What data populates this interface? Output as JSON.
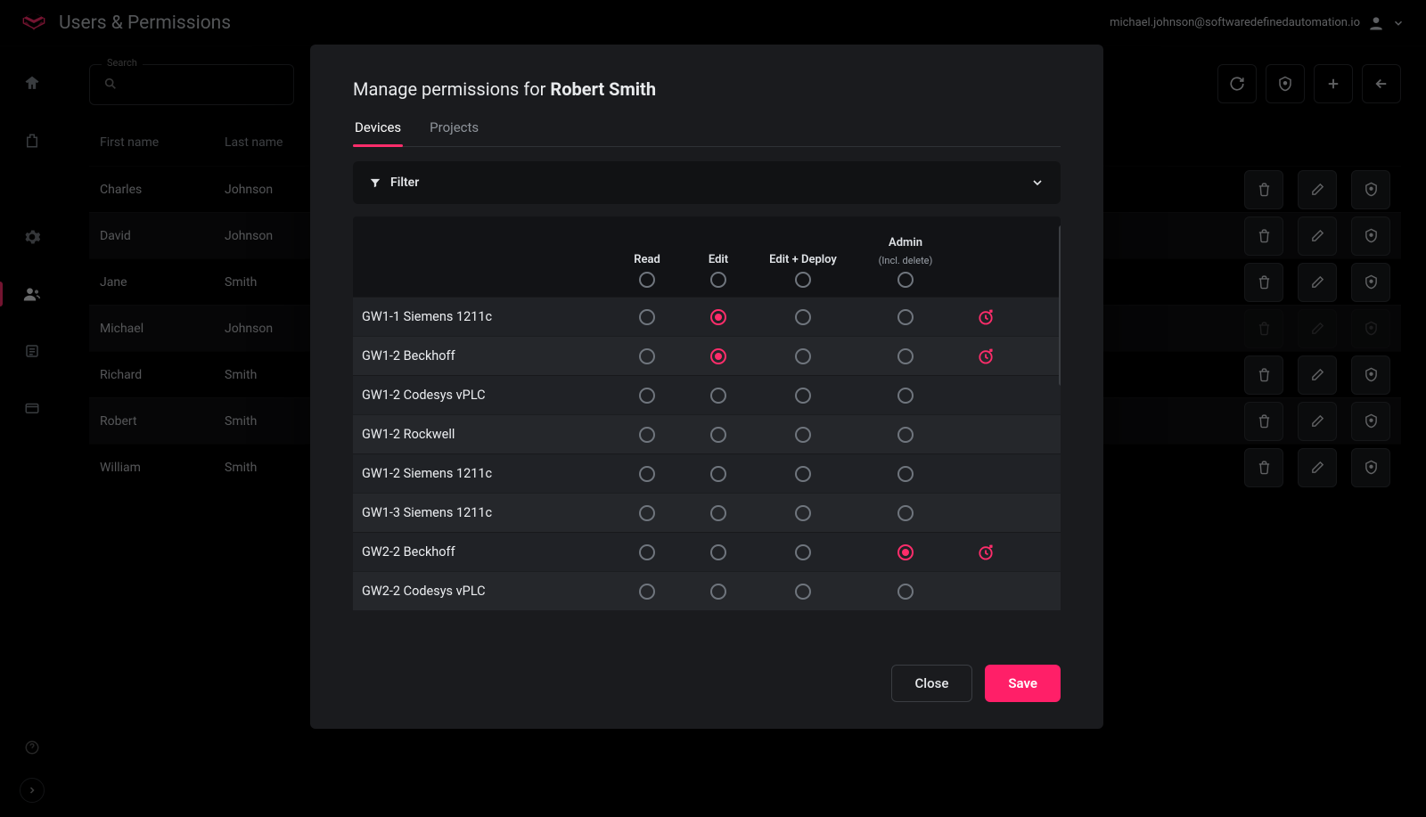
{
  "page_title": "Users & Permissions",
  "user_email": "michael.johnson@softwaredefinedautomation.io",
  "search": {
    "label": "Search",
    "value": ""
  },
  "columns": {
    "first": "First name",
    "last": "Last name"
  },
  "users": [
    {
      "first": "Charles",
      "last": "Johnson",
      "disabled": false
    },
    {
      "first": "David",
      "last": "Johnson",
      "disabled": false
    },
    {
      "first": "Jane",
      "last": "Smith",
      "disabled": false
    },
    {
      "first": "Michael",
      "last": "Johnson",
      "disabled": true
    },
    {
      "first": "Richard",
      "last": "Smith",
      "disabled": false
    },
    {
      "first": "Robert",
      "last": "Smith",
      "disabled": false
    },
    {
      "first": "William",
      "last": "Smith",
      "disabled": false
    }
  ],
  "modal": {
    "title_prefix": "Manage permissions for ",
    "title_subject": "Robert Smith",
    "tabs": {
      "devices": "Devices",
      "projects": "Projects"
    },
    "filter_label": "Filter",
    "perm_columns": {
      "read": "Read",
      "edit": "Edit",
      "editdeploy": "Edit + Deploy",
      "admin": "Admin",
      "admin_sub": "(Incl. delete)"
    },
    "devices": [
      {
        "name": "GW1-1 Siemens 1211c",
        "sel": "edit",
        "temp": true
      },
      {
        "name": "GW1-2 Beckhoff",
        "sel": "edit",
        "temp": true
      },
      {
        "name": "GW1-2 Codesys vPLC",
        "sel": null,
        "temp": false
      },
      {
        "name": "GW1-2 Rockwell",
        "sel": null,
        "temp": false
      },
      {
        "name": "GW1-2 Siemens 1211c",
        "sel": null,
        "temp": false
      },
      {
        "name": "GW1-3 Siemens 1211c",
        "sel": null,
        "temp": false
      },
      {
        "name": "GW2-2 Beckhoff",
        "sel": "admin",
        "temp": true
      },
      {
        "name": "GW2-2 Codesys vPLC",
        "sel": null,
        "temp": false
      }
    ],
    "buttons": {
      "close": "Close",
      "save": "Save"
    }
  }
}
